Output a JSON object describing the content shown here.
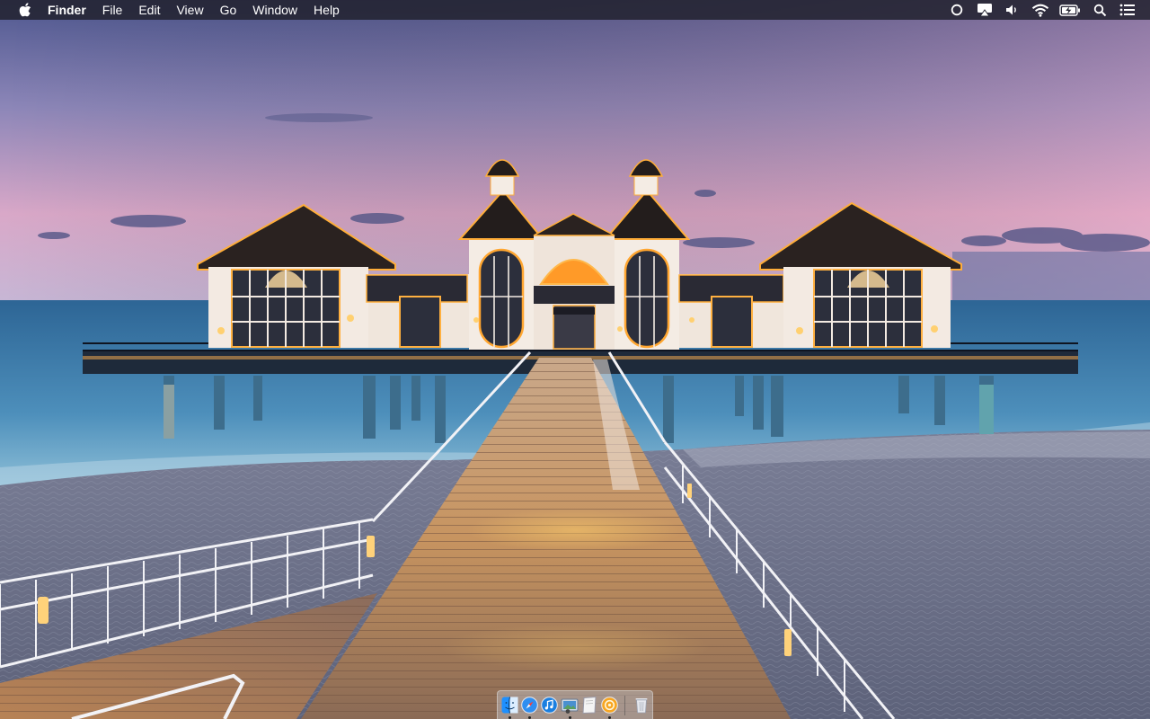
{
  "menubar": {
    "apple_icon": "apple-icon",
    "app_name": "Finder",
    "items": [
      "File",
      "Edit",
      "View",
      "Go",
      "Window",
      "Help"
    ],
    "status_icons": [
      "circle-status-icon",
      "airplay-icon",
      "volume-icon",
      "wifi-icon",
      "battery-charging-icon",
      "spotlight-search-icon",
      "notification-center-icon"
    ]
  },
  "dock": {
    "apps": [
      {
        "name": "finder-icon",
        "running": true
      },
      {
        "name": "safari-icon",
        "running": true
      },
      {
        "name": "itunes-icon",
        "running": false
      },
      {
        "name": "preview-icon",
        "running": true
      },
      {
        "name": "document-icon",
        "running": false
      },
      {
        "name": "orange-app-icon",
        "running": true
      }
    ],
    "trash_icon": "trash-icon"
  },
  "colors": {
    "menubar_bg": "#22222e",
    "sky_top": "#5a5f9c",
    "sky_bottom": "#f0b1c8",
    "sea": "#3f7ea8",
    "lights": "#ffb030"
  }
}
